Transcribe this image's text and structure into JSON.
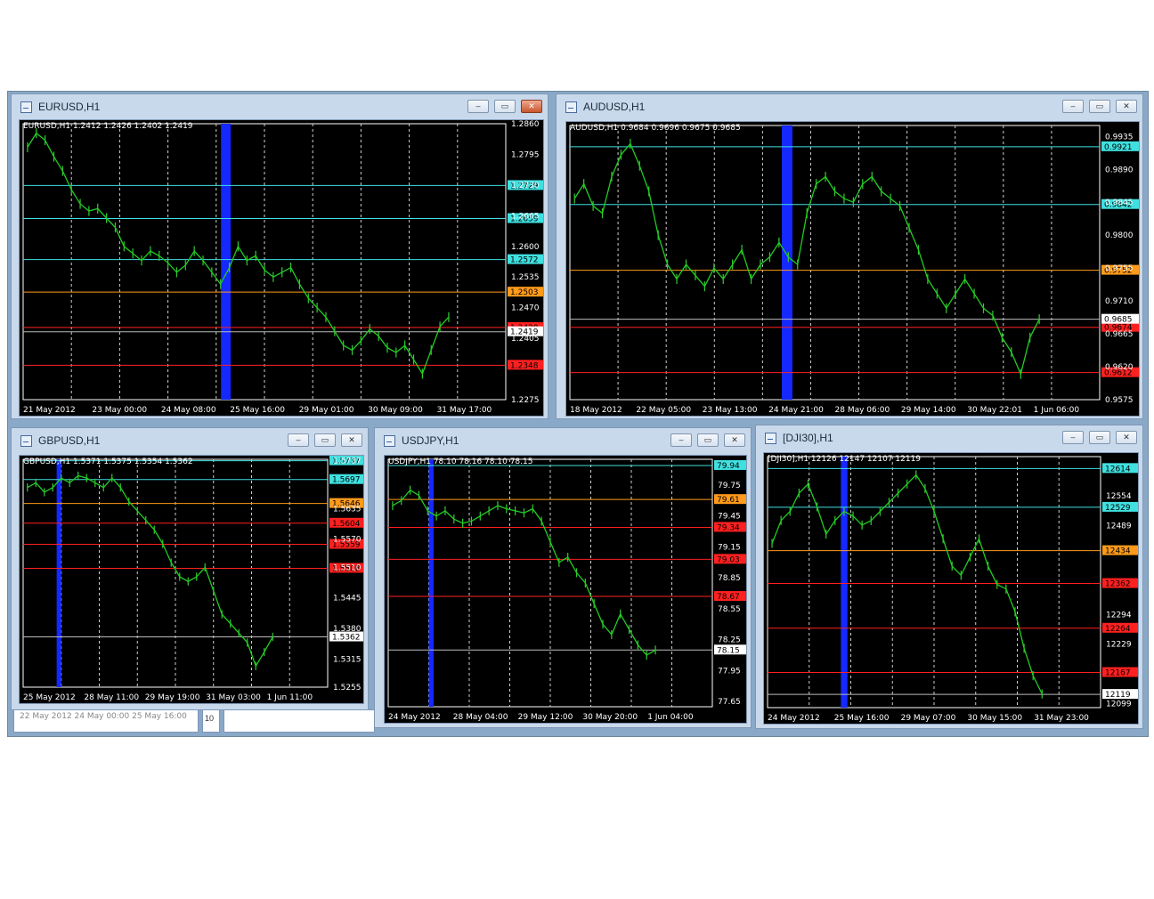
{
  "windows": [
    {
      "id": "eurusd",
      "title": "EURUSD,H1",
      "header": "EURUSD,H1  1.2412 1.2426 1.2402 1.2419",
      "close_active": true,
      "x_labels": [
        "21 May 2012",
        "23 May 00:00",
        "24 May 08:00",
        "25 May 16:00",
        "29 May 01:00",
        "30 May 09:00",
        "31 May 17:00"
      ],
      "y_labels": [
        "1.2860",
        "1.2795",
        "1.2730",
        "1.2665",
        "1.2600",
        "1.2535",
        "1.2470",
        "1.2405",
        "1.2275"
      ],
      "y_min": 1.2275,
      "y_max": 1.286,
      "levels": [
        {
          "value": 1.2729,
          "label": "1.2729",
          "color": "#40e0e0"
        },
        {
          "value": 1.2659,
          "label": "1.2659",
          "color": "#40e0e0"
        },
        {
          "value": 1.2572,
          "label": "1.2572",
          "color": "#40e0e0"
        },
        {
          "value": 1.2503,
          "label": "1.2503",
          "color": "#ff9a1a"
        },
        {
          "value": 1.2428,
          "label": "1.2428",
          "color": "#ff2020"
        },
        {
          "value": 1.2348,
          "label": "1.2348",
          "color": "#ff2020"
        }
      ],
      "current": {
        "value": 1.2419,
        "label": "1.2419"
      },
      "series": [
        1.281,
        1.284,
        1.2825,
        1.279,
        1.276,
        1.272,
        1.269,
        1.2675,
        1.268,
        1.266,
        1.264,
        1.26,
        1.2585,
        1.257,
        1.259,
        1.258,
        1.2565,
        1.2545,
        1.256,
        1.259,
        1.257,
        1.2545,
        1.252,
        1.2555,
        1.26,
        1.257,
        1.258,
        1.255,
        1.2535,
        1.2545,
        1.2555,
        1.252,
        1.249,
        1.247,
        1.245,
        1.242,
        1.239,
        1.238,
        1.24,
        1.2425,
        1.241,
        1.2385,
        1.2375,
        1.239,
        1.236,
        1.233,
        1.238,
        1.243,
        1.245
      ],
      "highlight": {
        "from": 0.41,
        "to": 0.43
      }
    },
    {
      "id": "audusd",
      "title": "AUDUSD,H1",
      "header": "AUDUSD,H1  0.9684 0.9696 0.9675 0.9685",
      "close_active": false,
      "x_labels": [
        "18 May 2012",
        "22 May 05:00",
        "23 May 13:00",
        "24 May 21:00",
        "28 May 06:00",
        "29 May 14:00",
        "30 May 22:01",
        "1 Jun 06:00"
      ],
      "y_labels": [
        "0.9935",
        "0.9890",
        "0.9845",
        "0.9800",
        "0.9755",
        "0.9710",
        "0.9665",
        "0.9620",
        "0.9575"
      ],
      "y_min": 0.9575,
      "y_max": 0.995,
      "levels": [
        {
          "value": 0.9921,
          "label": "0.9921",
          "color": "#40e0e0"
        },
        {
          "value": 0.9842,
          "label": "0.9842",
          "color": "#40e0e0"
        },
        {
          "value": 0.9752,
          "label": "0.9752",
          "color": "#ff9a1a"
        },
        {
          "value": 0.9674,
          "label": "0.9674",
          "color": "#ff2020"
        },
        {
          "value": 0.9612,
          "label": "0.9612",
          "color": "#ff2020"
        }
      ],
      "current": {
        "value": 0.9685,
        "label": "0.9685"
      },
      "series": [
        0.985,
        0.987,
        0.984,
        0.983,
        0.988,
        0.991,
        0.9925,
        0.9895,
        0.986,
        0.98,
        0.976,
        0.974,
        0.976,
        0.9745,
        0.973,
        0.9755,
        0.974,
        0.976,
        0.978,
        0.974,
        0.976,
        0.977,
        0.979,
        0.977,
        0.976,
        0.983,
        0.987,
        0.988,
        0.986,
        0.985,
        0.9845,
        0.987,
        0.988,
        0.986,
        0.985,
        0.984,
        0.981,
        0.978,
        0.974,
        0.972,
        0.97,
        0.972,
        0.974,
        0.972,
        0.97,
        0.969,
        0.966,
        0.964,
        0.961,
        0.966,
        0.9685
      ],
      "highlight": {
        "from": 0.4,
        "to": 0.42
      }
    },
    {
      "id": "gbpusd",
      "title": "GBPUSD,H1",
      "header": "GBPUSD,H1  1.5371 1.5375 1.5354 1.5362",
      "close_active": false,
      "x_labels": [
        "25 May 2012",
        "28 May 11:00",
        "29 May 19:00",
        "31 May 03:00",
        "1 Jun 11:00"
      ],
      "y_labels": [
        "1.5737",
        "1.5635",
        "1.5570",
        "1.5510",
        "1.5445",
        "1.5380",
        "1.5315",
        "1.5255"
      ],
      "y_min": 1.5255,
      "y_max": 1.574,
      "levels": [
        {
          "value": 1.5737,
          "label": "1.5737",
          "color": "#40e0e0"
        },
        {
          "value": 1.5697,
          "label": "1.5697",
          "color": "#40e0e0"
        },
        {
          "value": 1.5646,
          "label": "1.5646",
          "color": "#ff9a1a"
        },
        {
          "value": 1.5604,
          "label": "1.5604",
          "color": "#ff2020"
        },
        {
          "value": 1.5559,
          "label": "1.5559",
          "color": "#ff2020"
        },
        {
          "value": 1.5508,
          "label": "1.5508",
          "color": "#ff2020"
        }
      ],
      "current": {
        "value": 1.5362,
        "label": "1.5362"
      },
      "series": [
        1.568,
        1.569,
        1.567,
        1.568,
        1.57,
        1.569,
        1.5705,
        1.57,
        1.569,
        1.568,
        1.57,
        1.568,
        1.565,
        1.563,
        1.561,
        1.559,
        1.556,
        1.552,
        1.549,
        1.548,
        1.549,
        1.551,
        1.546,
        1.541,
        1.539,
        1.537,
        1.535,
        1.53,
        1.533,
        1.5362
      ],
      "highlight": {
        "from": 0.11,
        "to": 0.125
      }
    },
    {
      "id": "usdjpy",
      "title": "USDJPY,H1",
      "header": "USDJPY,H1  78.10 78.16 78.10 78.15",
      "close_active": false,
      "x_labels": [
        "24 May 2012",
        "28 May 04:00",
        "29 May 12:00",
        "30 May 20:00",
        "1 Jun 04:00"
      ],
      "y_labels": [
        "79.75",
        "79.45",
        "79.15",
        "78.85",
        "78.55",
        "78.25",
        "77.95",
        "77.65"
      ],
      "y_min": 77.6,
      "y_max": 80.0,
      "levels": [
        {
          "value": 79.94,
          "label": "79.94",
          "color": "#40e0e0"
        },
        {
          "value": 79.61,
          "label": "79.61",
          "color": "#ff9a1a"
        },
        {
          "value": 79.34,
          "label": "79.34",
          "color": "#ff2020"
        },
        {
          "value": 79.03,
          "label": "79.03",
          "color": "#ff2020"
        },
        {
          "value": 78.67,
          "label": "78.67",
          "color": "#ff2020"
        }
      ],
      "current": {
        "value": 78.15,
        "label": "78.15"
      },
      "series": [
        79.55,
        79.6,
        79.7,
        79.65,
        79.5,
        79.45,
        79.5,
        79.42,
        79.38,
        79.4,
        79.45,
        79.5,
        79.55,
        79.52,
        79.5,
        79.48,
        79.52,
        79.4,
        79.2,
        79.0,
        79.05,
        78.9,
        78.8,
        78.6,
        78.4,
        78.3,
        78.5,
        78.35,
        78.2,
        78.1,
        78.15
      ],
      "highlight": {
        "from": 0.125,
        "to": 0.14
      }
    },
    {
      "id": "dji30",
      "title": "[DJI30],H1",
      "header": "[DJI30],H1  12126 12147 12107 12119",
      "close_active": false,
      "x_labels": [
        "24 May 2012",
        "25 May 16:00",
        "29 May 07:00",
        "30 May 15:00",
        "31 May 23:00"
      ],
      "y_labels": [
        "12554",
        "12489",
        "12294",
        "12229",
        "12099"
      ],
      "y_min": 12090,
      "y_max": 12640,
      "levels": [
        {
          "value": 12614,
          "label": "12614",
          "color": "#40e0e0"
        },
        {
          "value": 12529,
          "label": "12529",
          "color": "#40e0e0"
        },
        {
          "value": 12434,
          "label": "12434",
          "color": "#ff9a1a"
        },
        {
          "value": 12362,
          "label": "12362",
          "color": "#ff2020"
        },
        {
          "value": 12264,
          "label": "12264",
          "color": "#ff2020"
        },
        {
          "value": 12167,
          "label": "12167",
          "color": "#ff2020"
        }
      ],
      "current": {
        "value": 12119,
        "label": "12119"
      },
      "series": [
        12450,
        12500,
        12520,
        12560,
        12580,
        12530,
        12470,
        12500,
        12520,
        12510,
        12490,
        12500,
        12520,
        12540,
        12560,
        12580,
        12600,
        12570,
        12520,
        12460,
        12400,
        12380,
        12420,
        12460,
        12400,
        12360,
        12350,
        12300,
        12220,
        12160,
        12120
      ],
      "highlight": {
        "from": 0.22,
        "to": 0.24
      }
    }
  ],
  "background_fragments": {
    "left_dates": "22 May 2012    24 May 00:00   25 May 16:00",
    "small_label": "10"
  }
}
